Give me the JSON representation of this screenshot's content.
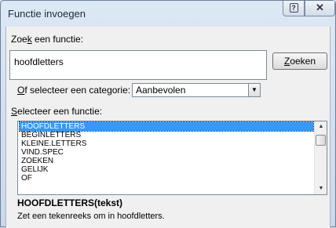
{
  "window": {
    "title": "Functie invoegen",
    "help_label": "?",
    "close_label": "✕"
  },
  "search": {
    "label_pre": "Zoe",
    "label_key": "k",
    "label_post": " een functie:",
    "value": "hoofdletters",
    "button_key": "Z",
    "button_rest": "oeken"
  },
  "category": {
    "label_key": "O",
    "label_rest": "f selecteer een categorie:",
    "selected": "Aanbevolen"
  },
  "functions": {
    "label_key": "S",
    "label_rest": "electeer een functie:",
    "items": [
      "HOOFDLETTERS",
      "BEGINLETTERS",
      "KLEINE.LETTERS",
      "VIND.SPEC",
      "ZOEKEN",
      "GELIJK",
      "OF"
    ],
    "selected_index": 0
  },
  "description": {
    "signature": "HOOFDLETTERS(tekst)",
    "text": "Zet een tekenreeks om in hoofdletters."
  },
  "colors": {
    "selection": "#3399ff",
    "title_gradient": "#dde8f5"
  }
}
